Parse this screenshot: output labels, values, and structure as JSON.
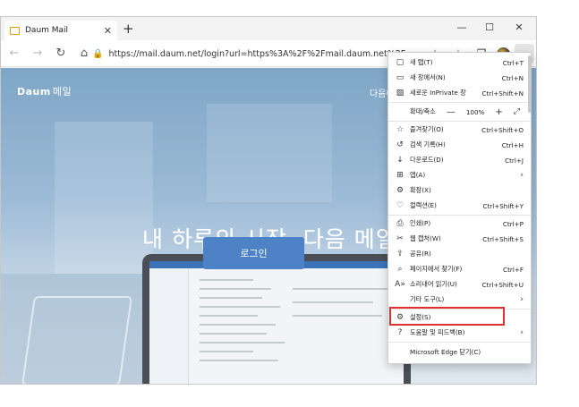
{
  "window": {
    "tab_title": "Daum Mail",
    "tab_close": "✕",
    "new_tab": "+",
    "controls": {
      "minimize": "—",
      "maximize": "☐",
      "close": "✕"
    }
  },
  "toolbar": {
    "back": "←",
    "forward": "→",
    "refresh": "↻",
    "home": "⌂",
    "lock": "🔒",
    "url": "https://mail.daum.net/login?url=https%3A%2F%2Fmail.daum.net%2F",
    "star_plus": "☆",
    "favorites": "☆",
    "collections": "❐",
    "more": "···"
  },
  "page": {
    "logo": "Daum",
    "logo_suffix": "메일",
    "top_link": "다음에",
    "hero": "내 하루의 시작, 다음 메일",
    "login_button": "로그인"
  },
  "menu": {
    "items": [
      {
        "icon": "▢",
        "label": "새 탭(T)",
        "shortcut": "Ctrl+T"
      },
      {
        "icon": "▭",
        "label": "새 창에서(N)",
        "shortcut": "Ctrl+N"
      },
      {
        "icon": "▨",
        "label": "새로운 InPrivate 창",
        "shortcut": "Ctrl+Shift+N"
      },
      {
        "label": "확대/축소",
        "zoom_minus": "—",
        "zoom_value": "100%",
        "zoom_plus": "+",
        "fullscreen": "⤢"
      },
      {
        "icon": "☆",
        "label": "즐겨찾기(O)",
        "shortcut": "Ctrl+Shift+O"
      },
      {
        "icon": "↺",
        "label": "검색 기록(H)",
        "shortcut": "Ctrl+H"
      },
      {
        "icon": "↓",
        "label": "다운로드(D)",
        "shortcut": "Ctrl+J"
      },
      {
        "icon": "⊞",
        "label": "앱(A)",
        "arrow": "›"
      },
      {
        "icon": "⚙",
        "label": "확장(X)"
      },
      {
        "icon": "♡",
        "label": "컬렉션(E)",
        "shortcut": "Ctrl+Shift+Y"
      },
      {
        "icon": "⎙",
        "label": "인쇄(P)",
        "shortcut": "Ctrl+P"
      },
      {
        "icon": "✂",
        "label": "웹 캡처(W)",
        "shortcut": "Ctrl+Shift+S"
      },
      {
        "icon": "⇪",
        "label": "공유(R)"
      },
      {
        "icon": "⌕",
        "label": "페이지에서 찾기(F)",
        "shortcut": "Ctrl+F"
      },
      {
        "icon": "A»",
        "label": "소리내어 읽기(U)",
        "shortcut": "Ctrl+Shift+U"
      },
      {
        "icon": "",
        "label": "기타 도구(L)",
        "arrow": "›"
      },
      {
        "icon": "⚙",
        "label": "설정(S)"
      },
      {
        "icon": "?",
        "label": "도움말 및 피드백(B)",
        "arrow": "›"
      },
      {
        "icon": "",
        "label": "Microsoft Edge 닫기(C)"
      }
    ]
  },
  "colors": {
    "highlight": "#e03030",
    "login_button": "#4d82c6",
    "page_bg_top": "#7fa6c6"
  }
}
